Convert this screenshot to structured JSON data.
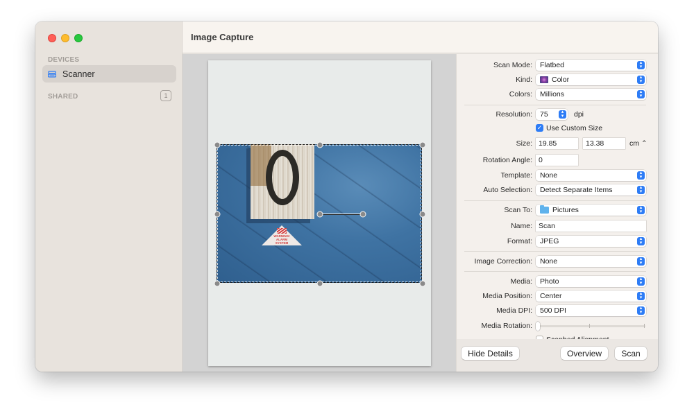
{
  "window": {
    "title": "Image Capture"
  },
  "sidebar": {
    "devices_header": "DEVICES",
    "shared_header": "SHARED",
    "shared_count": "1",
    "items": [
      {
        "label": "Scanner",
        "icon": "scanner-icon",
        "selected": true
      }
    ]
  },
  "preview": {
    "photo_sign_line1": "WARNING!",
    "photo_sign_line2": "ALARM SYSTEM"
  },
  "settings": {
    "scan_mode": {
      "label": "Scan Mode:",
      "value": "Flatbed"
    },
    "kind": {
      "label": "Kind:",
      "value": "Color",
      "icon": "color-kind-icon"
    },
    "colors": {
      "label": "Colors:",
      "value": "Millions"
    },
    "resolution": {
      "label": "Resolution:",
      "value": "75",
      "unit": "dpi"
    },
    "use_custom_size": {
      "label": "Use Custom Size",
      "checked": true
    },
    "size": {
      "label": "Size:",
      "width": "19.85",
      "height": "13.38",
      "unit": "cm"
    },
    "rotation_angle": {
      "label": "Rotation Angle:",
      "value": "0"
    },
    "template": {
      "label": "Template:",
      "value": "None"
    },
    "auto_selection": {
      "label": "Auto Selection:",
      "value": "Detect Separate Items"
    },
    "scan_to": {
      "label": "Scan To:",
      "value": "Pictures",
      "icon": "folder-icon"
    },
    "name": {
      "label": "Name:",
      "value": "Scan"
    },
    "format": {
      "label": "Format:",
      "value": "JPEG"
    },
    "image_correction": {
      "label": "Image Correction:",
      "value": "None"
    },
    "media": {
      "label": "Media:",
      "value": "Photo"
    },
    "media_position": {
      "label": "Media Position:",
      "value": "Center"
    },
    "media_dpi": {
      "label": "Media DPI:",
      "value": "500 DPI"
    },
    "media_rotation": {
      "label": "Media Rotation:",
      "value_fraction": 0
    },
    "scanbed_alignment": {
      "label": "Scanbed Alignment",
      "checked": false
    }
  },
  "buttons": {
    "hide_details": "Hide Details",
    "overview": "Overview",
    "scan": "Scan"
  },
  "colors": {
    "accent": "#2d7cf6",
    "close": "#ff5f57",
    "minimize": "#febc2e",
    "zoom": "#28c840"
  }
}
